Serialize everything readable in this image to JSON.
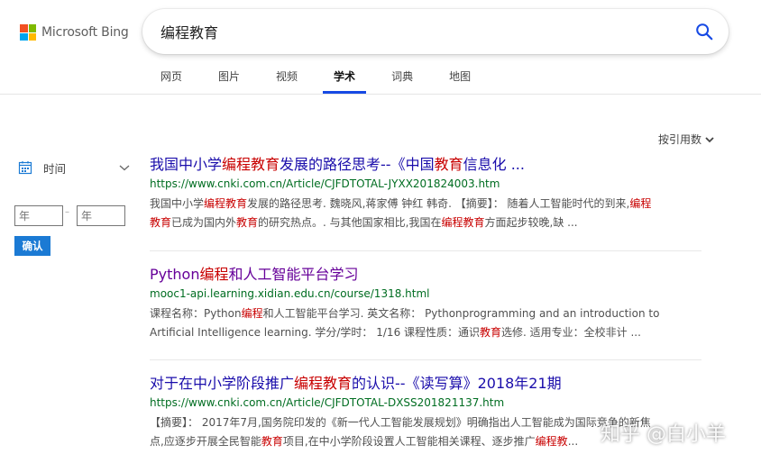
{
  "header": {
    "logo_text": "Microsoft Bing",
    "search_value": "编程教育",
    "search_icon": "search-icon"
  },
  "tabs": [
    {
      "label": "网页"
    },
    {
      "label": "图片"
    },
    {
      "label": "视频"
    },
    {
      "label": "学术",
      "active": true
    },
    {
      "label": "词典"
    },
    {
      "label": "地图"
    }
  ],
  "sort": {
    "label": "按引用数"
  },
  "sidebar": {
    "time_label": "时间",
    "year_from_placeholder": "年",
    "year_to_placeholder": "年",
    "dash": "–",
    "confirm_label": "确认"
  },
  "results": [
    {
      "title": [
        {
          "t": "我国中小学"
        },
        {
          "t": "编程教育",
          "hl": true
        },
        {
          "t": "发展的路径思考--《中国"
        },
        {
          "t": "教育",
          "hl": true
        },
        {
          "t": "信息化 ..."
        }
      ],
      "url": "https://www.cnki.com.cn/Article/CJFDTOTAL-JYXX201824003.htm",
      "snippet_lines": [
        [
          {
            "t": "我国中小学"
          },
          {
            "t": "编程教育",
            "hl": true
          },
          {
            "t": "发展的路径思考. 魏晓风,蒋家傅 钟红 韩奇. 【摘要】： 随着人工智能时代的到来,"
          },
          {
            "t": "编程",
            "hl": true
          }
        ],
        [
          {
            "t": "教育",
            "hl": true
          },
          {
            "t": "已成为国内外"
          },
          {
            "t": "教育",
            "hl": true
          },
          {
            "t": "的研究热点。. 与其他国家相比,我国在"
          },
          {
            "t": "编程教育",
            "hl": true
          },
          {
            "t": "方面起步较晚,缺 ..."
          }
        ]
      ]
    },
    {
      "visited": true,
      "title": [
        {
          "t": "Python"
        },
        {
          "t": "编程",
          "hl": true
        },
        {
          "t": "和人工智能平台学习"
        }
      ],
      "url": "mooc1-api.learning.xidian.edu.cn/course/1318.html",
      "snippet_lines": [
        [
          {
            "t": "课程名称：Python"
          },
          {
            "t": "编程",
            "hl": true
          },
          {
            "t": "和人工智能平台学习. 英文名称： Pythonprogramming and an introduction to"
          }
        ],
        [
          {
            "t": "Artificial Intelligence learning. 学分/学时： 1/16 课程性质：通识"
          },
          {
            "t": "教育",
            "hl": true
          },
          {
            "t": "选修. 适用专业：全校非计 ..."
          }
        ]
      ]
    },
    {
      "title": [
        {
          "t": "对于在中小学阶段推广"
        },
        {
          "t": "编程教育",
          "hl": true
        },
        {
          "t": "的认识--《读写算》2018年21期"
        }
      ],
      "url": "https://www.cnki.com.cn/Article/CJFDTOTAL-DXSS201821137.htm",
      "snippet_lines": [
        [
          {
            "t": "【摘要】： 2017年7月,国务院印发的《新一代人工智能发展规划》明确指出人工智能成为国际竞争的新焦"
          }
        ],
        [
          {
            "t": "点,应逐步开展全民智能"
          },
          {
            "t": "教育",
            "hl": true
          },
          {
            "t": "项目,在中小学阶段设置人工智能相关课程、逐步推广"
          },
          {
            "t": "编程教",
            "hl": true
          },
          {
            "t": "..."
          }
        ]
      ]
    }
  ],
  "watermark": "知乎 @白小羊",
  "colors": {
    "link": "#1a0dab",
    "visited": "#660099",
    "highlight": "#c80000",
    "url": "#006d21",
    "accent": "#174ae4",
    "confirm_button": "#1b7ad4"
  }
}
